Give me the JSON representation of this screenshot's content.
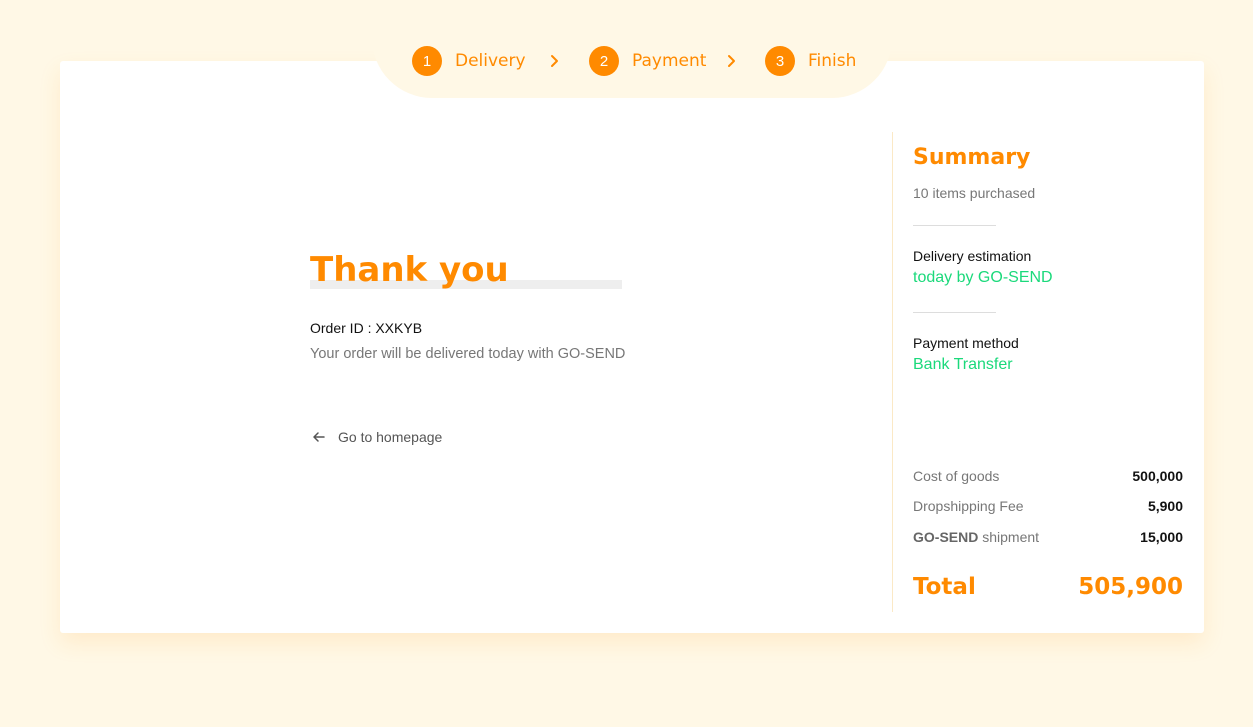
{
  "stepper": {
    "steps": [
      {
        "number": "1",
        "label": "Delivery"
      },
      {
        "number": "2",
        "label": "Payment"
      },
      {
        "number": "3",
        "label": "Finish"
      }
    ]
  },
  "main": {
    "title": "Thank you",
    "order_id": "Order ID : XXKYB",
    "message": "Your order will be delivered today with GO-SEND",
    "home_link": "Go to homepage"
  },
  "summary": {
    "title": "Summary",
    "items_purchased": "10 items purchased",
    "delivery_label": "Delivery estimation",
    "delivery_value": "today by GO-SEND",
    "payment_label": "Payment method",
    "payment_value": "Bank Transfer",
    "costs": [
      {
        "label": "Cost of goods",
        "value": "500,000"
      },
      {
        "label": "Dropshipping Fee",
        "value": "5,900"
      },
      {
        "label_bold": "GO-SEND",
        "label_rest": " shipment",
        "value": "15,000"
      }
    ],
    "total_label": "Total",
    "total_value": "505,900"
  },
  "colors": {
    "accent": "#ff8a00",
    "success": "#1bd97b",
    "background": "#fff8e6"
  },
  "icons": {
    "step_separator": "chevron-right-icon",
    "home_link": "arrow-left-icon"
  }
}
